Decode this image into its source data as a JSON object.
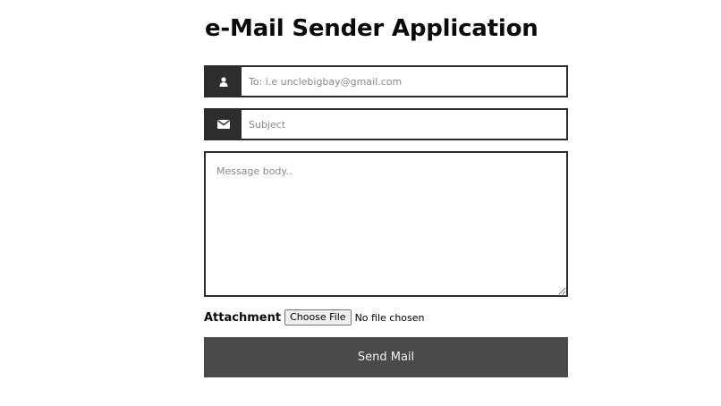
{
  "header": {
    "title": "e-Mail Sender Application"
  },
  "form": {
    "to": {
      "icon": "user-icon",
      "placeholder": "To: i.e unclebigbay@gmail.com",
      "value": ""
    },
    "subject": {
      "icon": "envelope-icon",
      "placeholder": "Subject",
      "value": ""
    },
    "message": {
      "placeholder": "Message body..",
      "value": ""
    },
    "attachment": {
      "label": "Attachment",
      "button_label": "Choose File",
      "status": "No file chosen"
    },
    "send_label": "Send Mail"
  },
  "colors": {
    "addon_bg": "#2d2d2d",
    "border": "#2b2b2b",
    "send_bg": "#4a4a4a",
    "send_text": "#f2f2f2"
  }
}
